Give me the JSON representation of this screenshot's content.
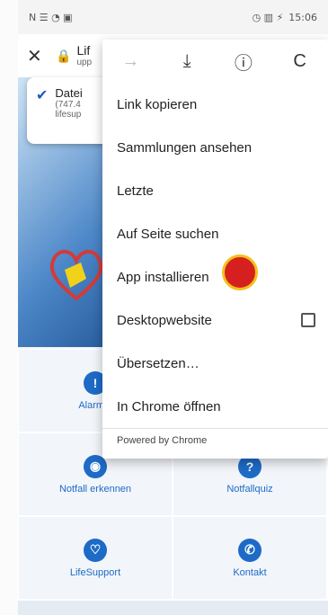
{
  "status": {
    "left": "N ☰ ◔ ▣",
    "time": "15:06",
    "right_icons": "◷ ▥ ⚡"
  },
  "urlbar": {
    "close_icon": "close-icon",
    "lock_icon": "lock-icon",
    "title": "Lif",
    "subtitle": "upp"
  },
  "download": {
    "title": "Datei",
    "detail1": "(747.4",
    "detail2": "lifesup"
  },
  "menu": {
    "tools": [
      "→",
      "⤓",
      "ⓘ",
      "C"
    ],
    "items": [
      "Link kopieren",
      "Sammlungen ansehen",
      "Letzte",
      "Auf Seite suchen",
      "App installieren",
      "Desktopwebsite",
      "Übersetzen…",
      "In Chrome öffnen"
    ],
    "powered": "Powered by Chrome"
  },
  "tiles": [
    {
      "label": "Alarmie",
      "icon": "!"
    },
    {
      "label": "",
      "icon": ""
    },
    {
      "label": "Notfall erkennen",
      "icon": "◉"
    },
    {
      "label": "Notfallquiz",
      "icon": "?"
    },
    {
      "label": "LifeSupport",
      "icon": "♡"
    },
    {
      "label": "Kontakt",
      "icon": "✆"
    }
  ]
}
